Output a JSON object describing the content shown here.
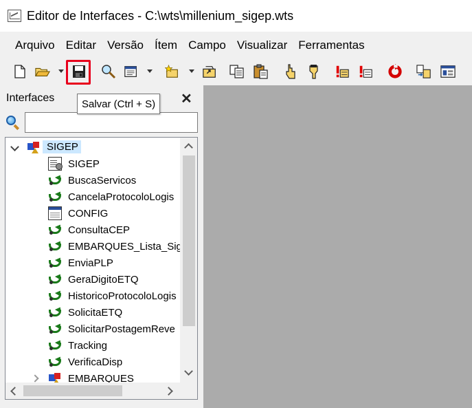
{
  "window": {
    "title": "Editor de Interfaces - C:\\wts\\millenium_sigep.wts"
  },
  "menubar": {
    "items": [
      "Arquivo",
      "Editar",
      "Versão",
      "Ítem",
      "Campo",
      "Visualizar",
      "Ferramentas"
    ]
  },
  "toolbar": {
    "tooltip": "Salvar (Ctrl + S)",
    "highlight_color": "#e8001c",
    "buttons": [
      {
        "icon": "new-document-icon"
      },
      {
        "icon": "open-folder-icon"
      },
      {
        "icon": "save-icon"
      },
      {
        "icon": "find-icon"
      },
      {
        "icon": "properties-icon"
      },
      {
        "icon": "new-item-icon"
      },
      {
        "icon": "open-item-icon"
      },
      {
        "icon": "copy-icon"
      },
      {
        "icon": "paste-icon"
      },
      {
        "icon": "pointer-icon"
      },
      {
        "icon": "hand-icon"
      },
      {
        "icon": "warning-list-icon"
      },
      {
        "icon": "error-list-icon"
      },
      {
        "icon": "refresh-icon"
      },
      {
        "icon": "transfer-icon"
      },
      {
        "icon": "window-icon"
      }
    ]
  },
  "panel": {
    "title": "Interfaces",
    "close_label": "✕",
    "search": {
      "value": "",
      "placeholder": ""
    },
    "tree": {
      "root": {
        "label": "SIGEP",
        "icon": "interface-icon",
        "expanded": true,
        "selected_color": "#cce8ff"
      },
      "children": [
        {
          "label": "SIGEP",
          "icon": "project-icon"
        },
        {
          "label": "BuscaServicos",
          "icon": "flow-icon"
        },
        {
          "label": "CancelaProtocoloLogis",
          "icon": "flow-icon"
        },
        {
          "label": "CONFIG",
          "icon": "table-icon"
        },
        {
          "label": "ConsultaCEP",
          "icon": "flow-icon"
        },
        {
          "label": "EMBARQUES_Lista_Sig",
          "icon": "flow-icon"
        },
        {
          "label": "EnviaPLP",
          "icon": "flow-icon"
        },
        {
          "label": "GeraDigitoETQ",
          "icon": "flow-icon"
        },
        {
          "label": "HistoricoProtocoloLogis",
          "icon": "flow-icon"
        },
        {
          "label": "SolicitaETQ",
          "icon": "flow-icon"
        },
        {
          "label": "SolicitarPostagemReve",
          "icon": "flow-icon"
        },
        {
          "label": "Tracking",
          "icon": "flow-icon"
        },
        {
          "label": "VerificaDisp",
          "icon": "flow-icon"
        }
      ],
      "sibling": {
        "label": "EMBARQUES",
        "icon": "interface-icon",
        "expanded": false
      }
    }
  }
}
